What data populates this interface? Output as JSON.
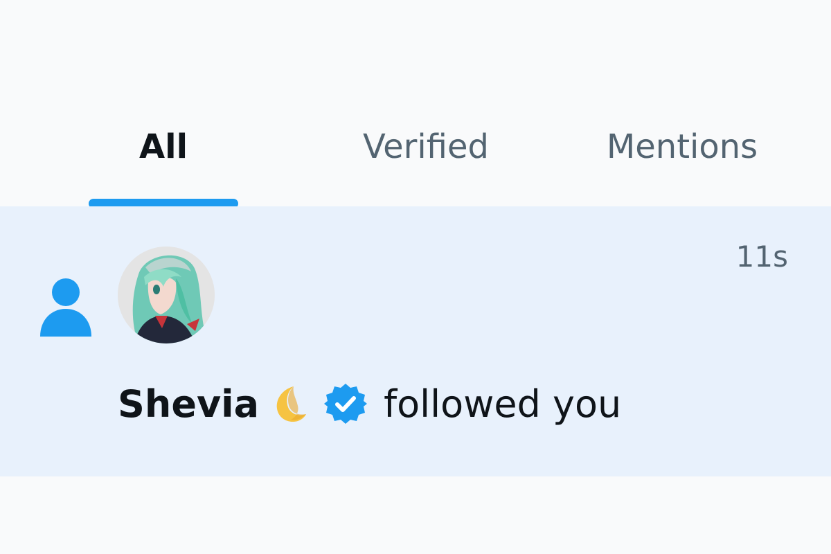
{
  "tabs": [
    {
      "label": "All",
      "active": true
    },
    {
      "label": "Verified",
      "active": false
    },
    {
      "label": "Mentions",
      "active": false
    }
  ],
  "notification": {
    "type_icon": "person-icon",
    "timestamp": "11s",
    "user_name": "Shevia",
    "name_emoji": "crescent-moon",
    "verified": true,
    "action_text": "followed you"
  },
  "colors": {
    "accent": "#1d9bf0",
    "row_highlight": "#e8f1fc",
    "text_primary": "#0f1419",
    "text_secondary": "#536471"
  }
}
